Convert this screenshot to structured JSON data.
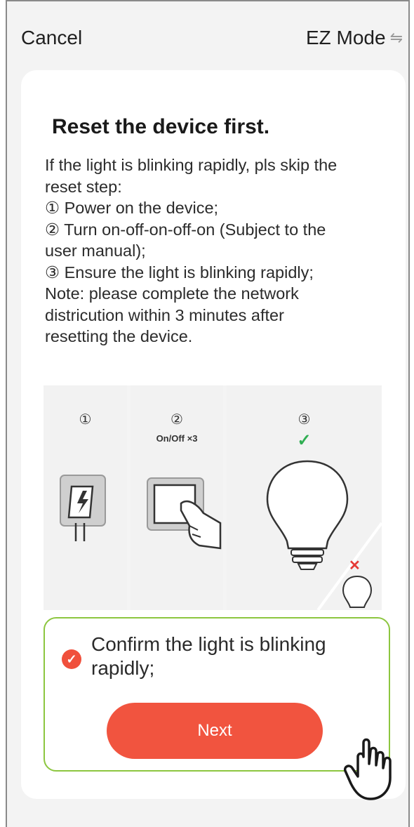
{
  "header": {
    "cancel_label": "Cancel",
    "mode_label": "EZ Mode",
    "mode_icon": "⇋"
  },
  "content": {
    "title": "Reset the device first.",
    "lines": [
      "If the light is blinking rapidly, pls skip the",
      "reset step:",
      "① Power on the device;",
      "② Turn on-off-on-off-on (Subject to the",
      "user manual);",
      "③ Ensure the light is blinking rapidly;",
      "Note: please complete the network",
      "districution within 3 minutes after",
      "resetting the device."
    ]
  },
  "illustration": {
    "steps": [
      {
        "num": "①",
        "caption": "",
        "icon": "power-plug-icon"
      },
      {
        "num": "②",
        "caption": "On/Off ×3",
        "icon": "wall-switch-icon"
      },
      {
        "num": "③",
        "caption": "",
        "icon": "light-bulb-icon"
      }
    ],
    "correct_mark": "✓",
    "wrong_mark": "✕"
  },
  "confirm": {
    "checked": true,
    "text": "Confirm the light is blinking rapidly;",
    "next_label": "Next"
  },
  "colors": {
    "accent": "#f1543f",
    "highlight_border": "#8cc63f",
    "check_green": "#2fae52",
    "cross_red": "#e53935"
  }
}
